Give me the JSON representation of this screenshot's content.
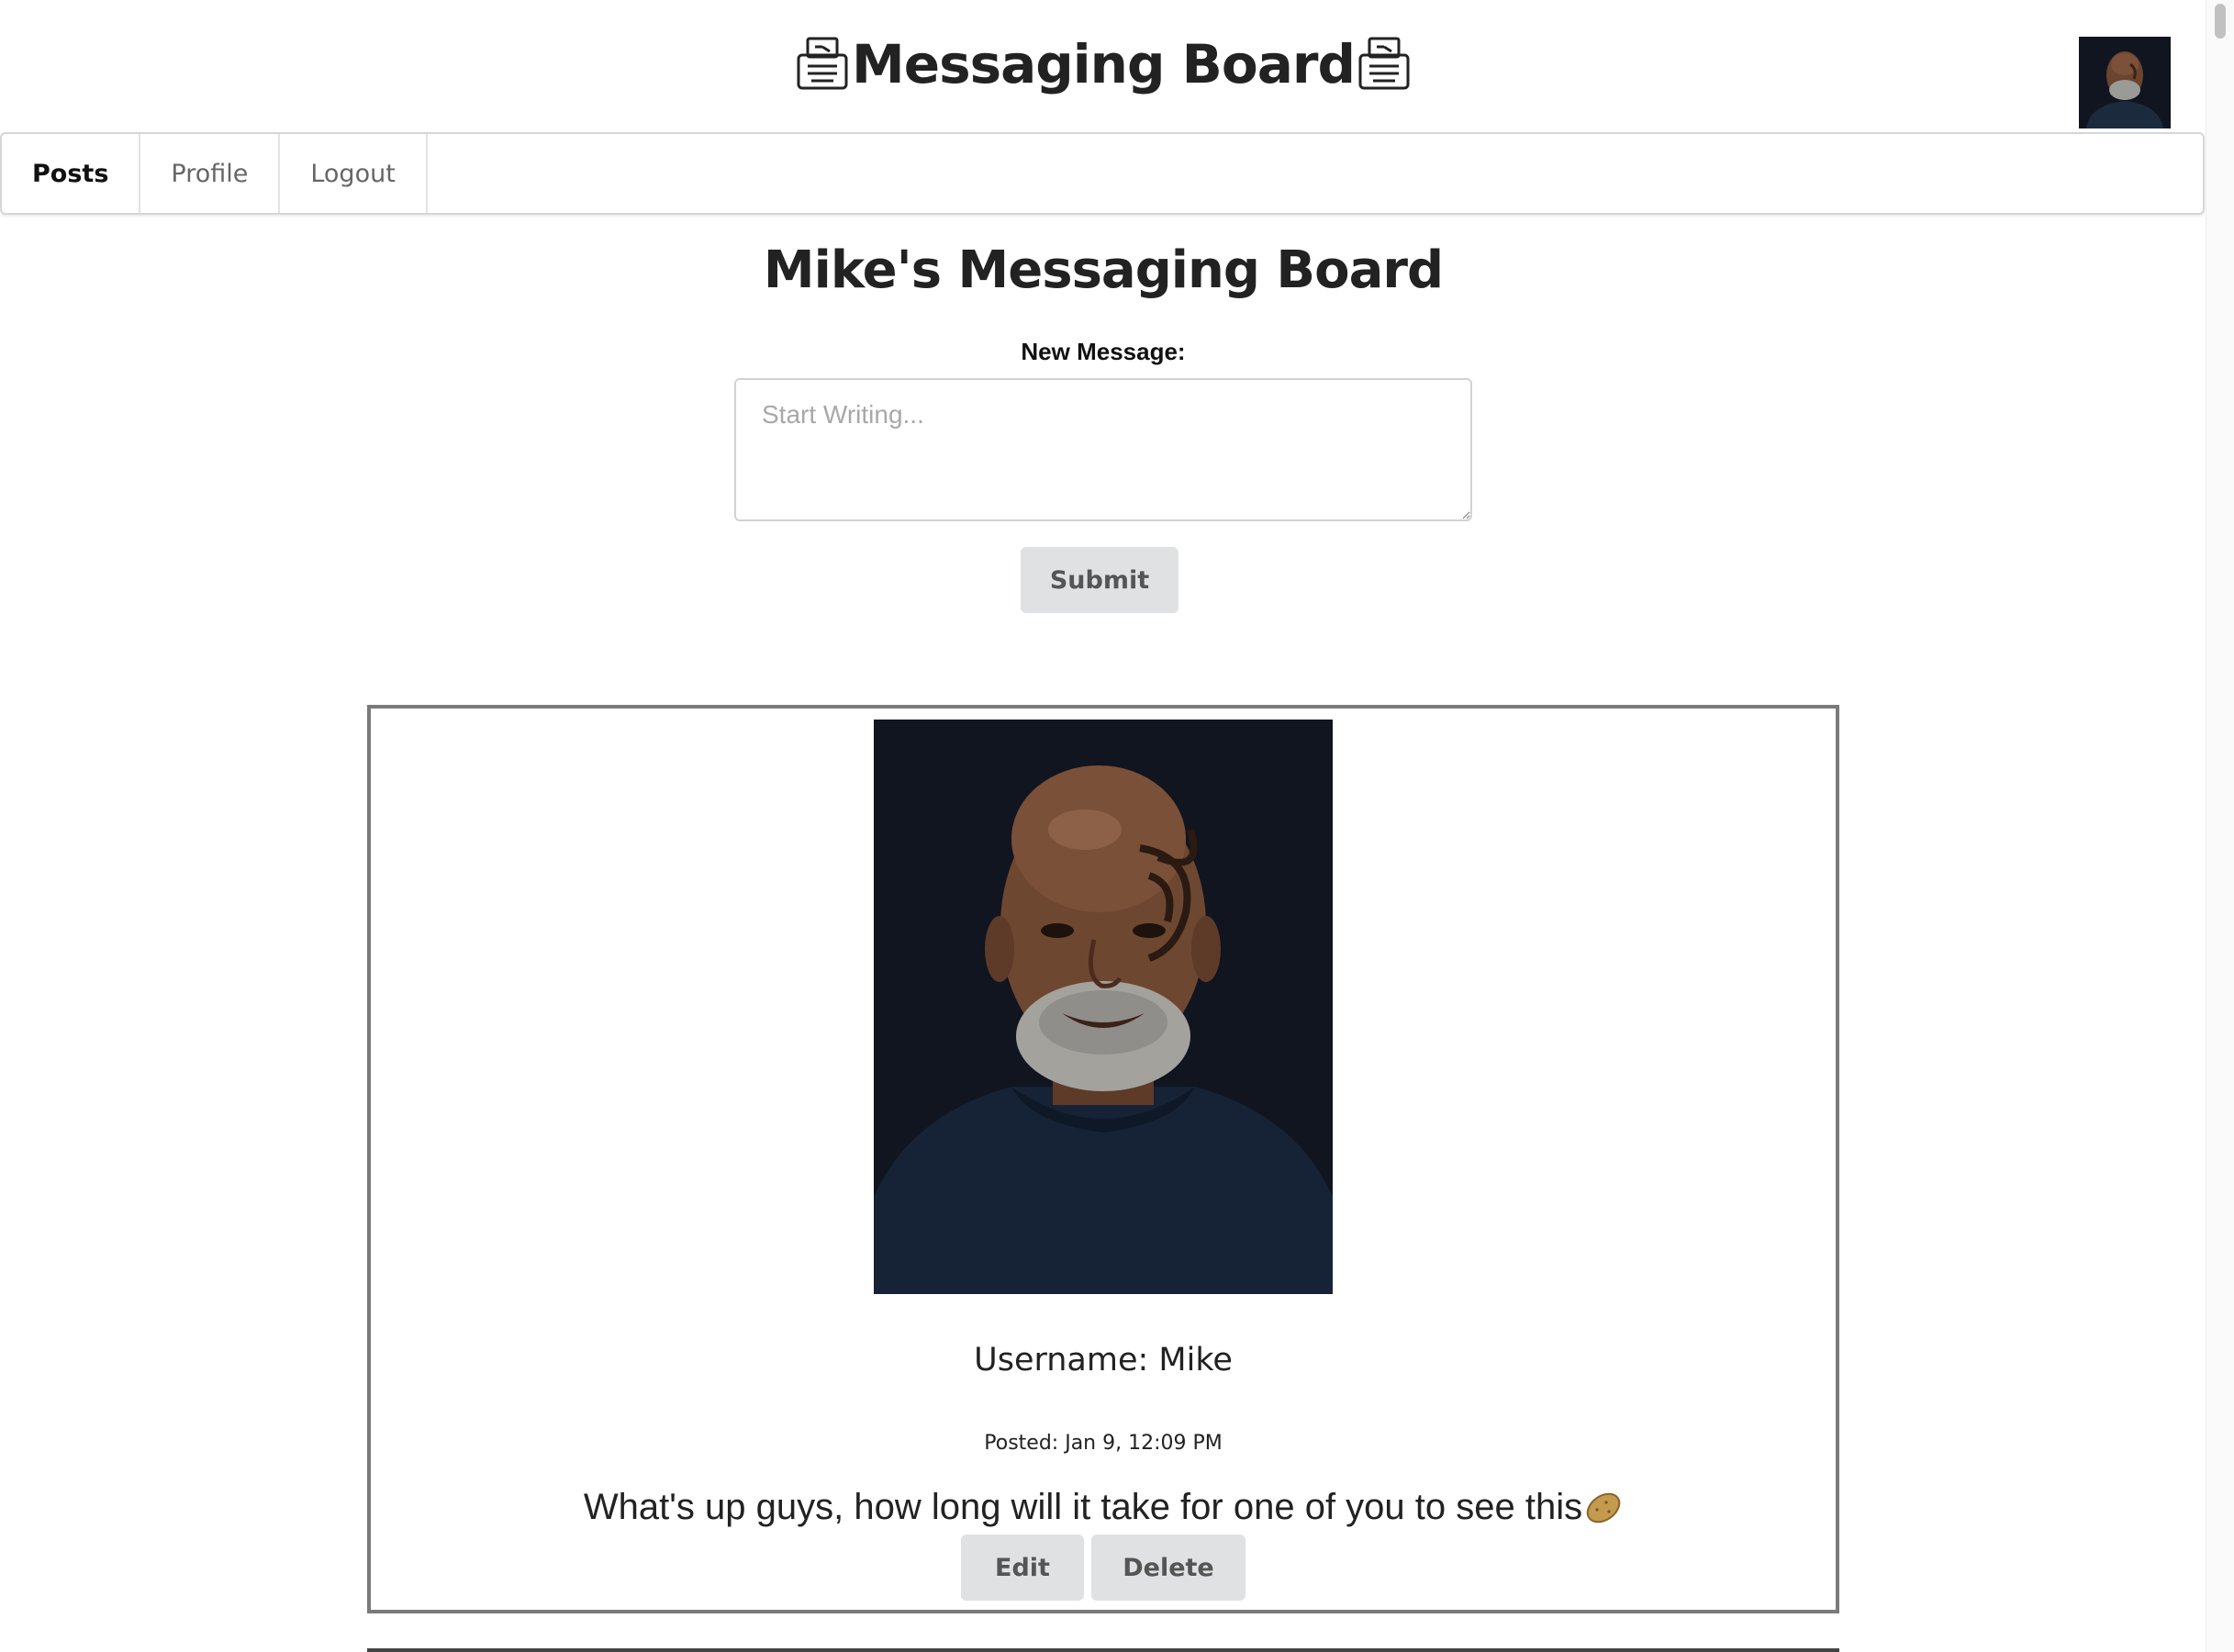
{
  "header": {
    "title": "Messaging Board",
    "title_icon": "typewriter-icon",
    "avatar_alt": "user-avatar"
  },
  "nav": {
    "items": [
      {
        "label": "Posts",
        "active": true
      },
      {
        "label": "Profile",
        "active": false
      },
      {
        "label": "Logout",
        "active": false
      }
    ]
  },
  "main": {
    "board_title": "Mike's Messaging Board",
    "new_message_label": "New Message:",
    "new_message_placeholder": "Start Writing...",
    "new_message_value": "",
    "submit_label": "Submit"
  },
  "posts": [
    {
      "username_label": "Username: Mike",
      "posted_label": "Posted: Jan 9, 12:09 PM",
      "text": "What's up guys, how long will it take for one of you to see this",
      "emoji": "potato-icon",
      "edit_label": "Edit",
      "delete_label": "Delete"
    }
  ],
  "colors": {
    "accent_button_bg": "#e0e1e2",
    "card_border": "#7a7a7a",
    "photo_bg": "#10151f"
  }
}
